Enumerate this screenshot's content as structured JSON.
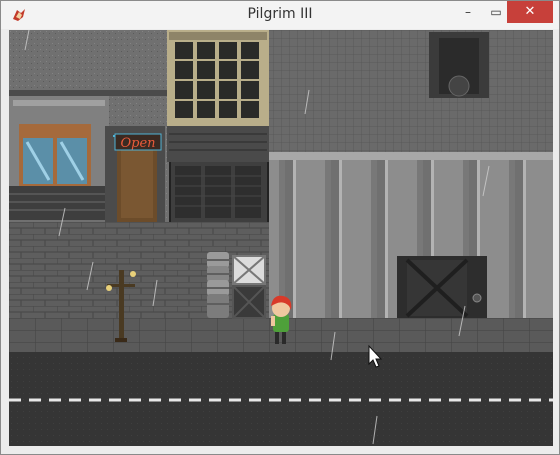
{
  "window": {
    "title": "Pilgrim III",
    "minimize_glyph": "–",
    "maximize_glyph": "▭",
    "close_glyph": "✕",
    "app_icon": "game-icon"
  },
  "scene": {
    "shop_sign": "Open",
    "colors": {
      "sky_wall": "#6d6d6d",
      "sidewalk": "#585858",
      "road": "#333333",
      "lane_mark": "#e8e8e8",
      "sign_neon": "#e85a3a",
      "sign_neon_blue": "#4fb3d6",
      "player_hair": "#d83a2a",
      "player_shirt": "#4ea03a"
    },
    "cursor": "arrow-cursor"
  }
}
